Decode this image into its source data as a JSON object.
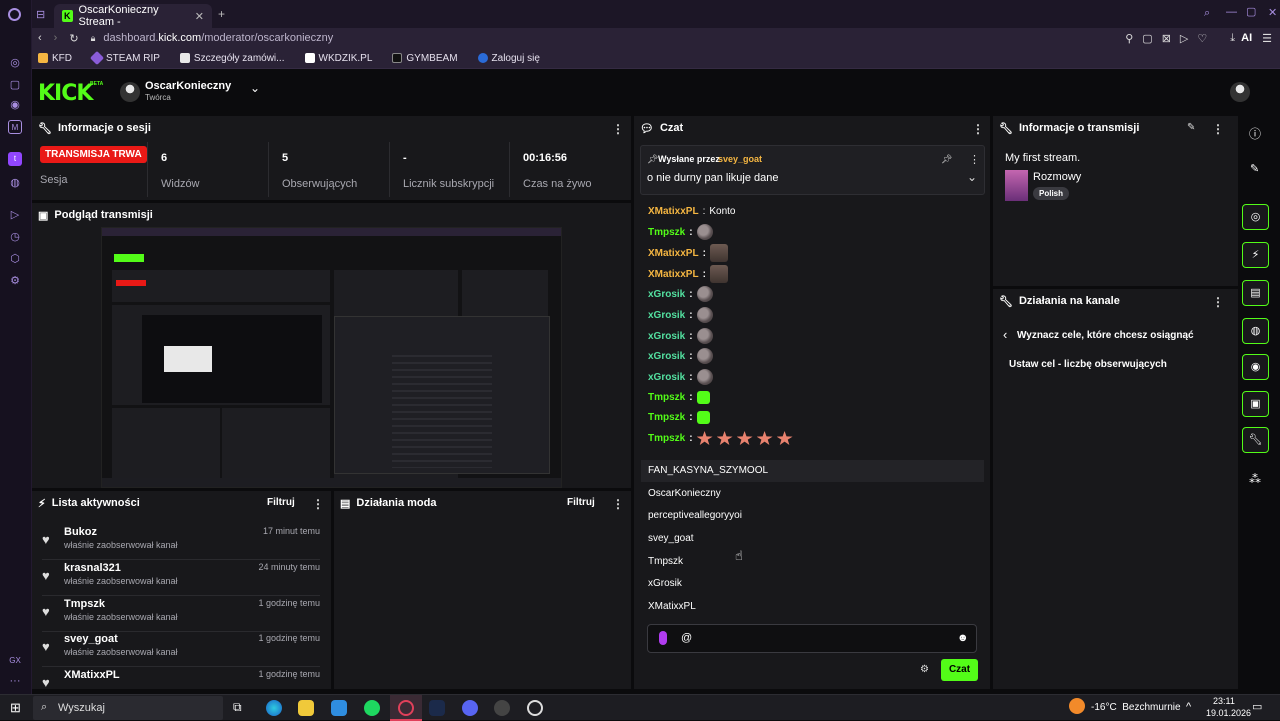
{
  "browser": {
    "tab_title": "OscarKonieczny Stream - ",
    "url_prefix": "dashboard.",
    "url_host": "kick.com",
    "url_path": "/moderator/oscarkonieczny",
    "ai_label": "AI",
    "bookmarks": [
      "KFD",
      "STEAM RIP",
      "Szczegóły zamówi...",
      "WKDZIK.PL",
      "GYMBEAM",
      "Zaloguj się"
    ]
  },
  "header": {
    "logo": "KICK",
    "beta": "BETA",
    "channel_name": "OscarKonieczny",
    "channel_role": "Twórca"
  },
  "session": {
    "title": "Informacje o sesji",
    "live_badge": "TRANSMISJA TRWA",
    "session_label": "Sesja",
    "viewers_value": "6",
    "viewers_label": "Widzów",
    "followers_value": "5",
    "followers_label": "Obserwujących",
    "subs_value": "-",
    "subs_label": "Licznik subskrypcji",
    "uptime_value": "00:16:56",
    "uptime_label": "Czas na żywo"
  },
  "preview": {
    "title": "Podgląd transmisji"
  },
  "activity": {
    "title": "Lista aktywności",
    "filter_label": "Filtruj",
    "items": [
      {
        "name": "Bukoz",
        "action": "właśnie zaobserwował kanał",
        "time": "17 minut temu"
      },
      {
        "name": "krasnal321",
        "action": "właśnie zaobserwował kanał",
        "time": "24 minuty temu"
      },
      {
        "name": "Tmpszk",
        "action": "właśnie zaobserwował kanał",
        "time": "1 godzinę temu"
      },
      {
        "name": "svey_goat",
        "action": "właśnie zaobserwował kanał",
        "time": "1 godzinę temu"
      },
      {
        "name": "XMatixxPL",
        "action": "",
        "time": "1 godzinę temu"
      }
    ]
  },
  "mod_actions": {
    "title": "Działania moda",
    "filter_label": "Filtruj"
  },
  "chat": {
    "title": "Czat",
    "pinned_by_prefix": "Wysłane przez",
    "pinned_by_user": "svey_goat",
    "pinned_message": "o nie durny pan likuje dane",
    "messages": [
      {
        "user": "XMatixxPL",
        "text": "Konto",
        "color": "#f5b642"
      },
      {
        "user": "Tmpszk",
        "text": "",
        "color": "#53fc18"
      },
      {
        "user": "XMatixxPL",
        "text": "",
        "color": "#f5b642"
      },
      {
        "user": "XMatixxPL",
        "text": "",
        "color": "#f5b642"
      },
      {
        "user": "xGrosik",
        "text": "",
        "color": "#53e0a0"
      },
      {
        "user": "xGrosik",
        "text": "",
        "color": "#53e0a0"
      },
      {
        "user": "xGrosik",
        "text": "",
        "color": "#53e0a0"
      },
      {
        "user": "xGrosik",
        "text": "",
        "color": "#53e0a0"
      },
      {
        "user": "xGrosik",
        "text": "",
        "color": "#53e0a0"
      },
      {
        "user": "Tmpszk",
        "text": "",
        "color": "#53fc18"
      },
      {
        "user": "Tmpszk",
        "text": "",
        "color": "#53fc18"
      },
      {
        "user": "Tmpszk",
        "text": "",
        "color": "#53fc18"
      }
    ],
    "mention_suggestions": [
      "FAN_KASYNA_SZYMOOL",
      "OscarKonieczny",
      "perceptiveallegoryyoi",
      "svey_goat",
      "Tmpszk",
      "xGrosik",
      "XMatixxPL"
    ],
    "input_value": "@",
    "send_label": "Czat"
  },
  "stream_info": {
    "title": "Informacje o transmisji",
    "stream_title": "My first stream.",
    "category": "Rozmowy",
    "language": "Polish"
  },
  "channel_actions": {
    "title": "Działania na kanale",
    "goal_heading": "Wyznacz cele, które chcesz osiągnąć",
    "goal_option": "Ustaw cel - liczbę obserwujących"
  },
  "taskbar": {
    "search_placeholder": "Wyszukaj",
    "weather": "-16°C  Bezchmurnie",
    "time": "23:11",
    "date": "19.01.2026"
  },
  "colors": {
    "accent": "#53fc18",
    "live": "#e91916",
    "panel": "#18181b",
    "background": "#0b0b0d"
  }
}
